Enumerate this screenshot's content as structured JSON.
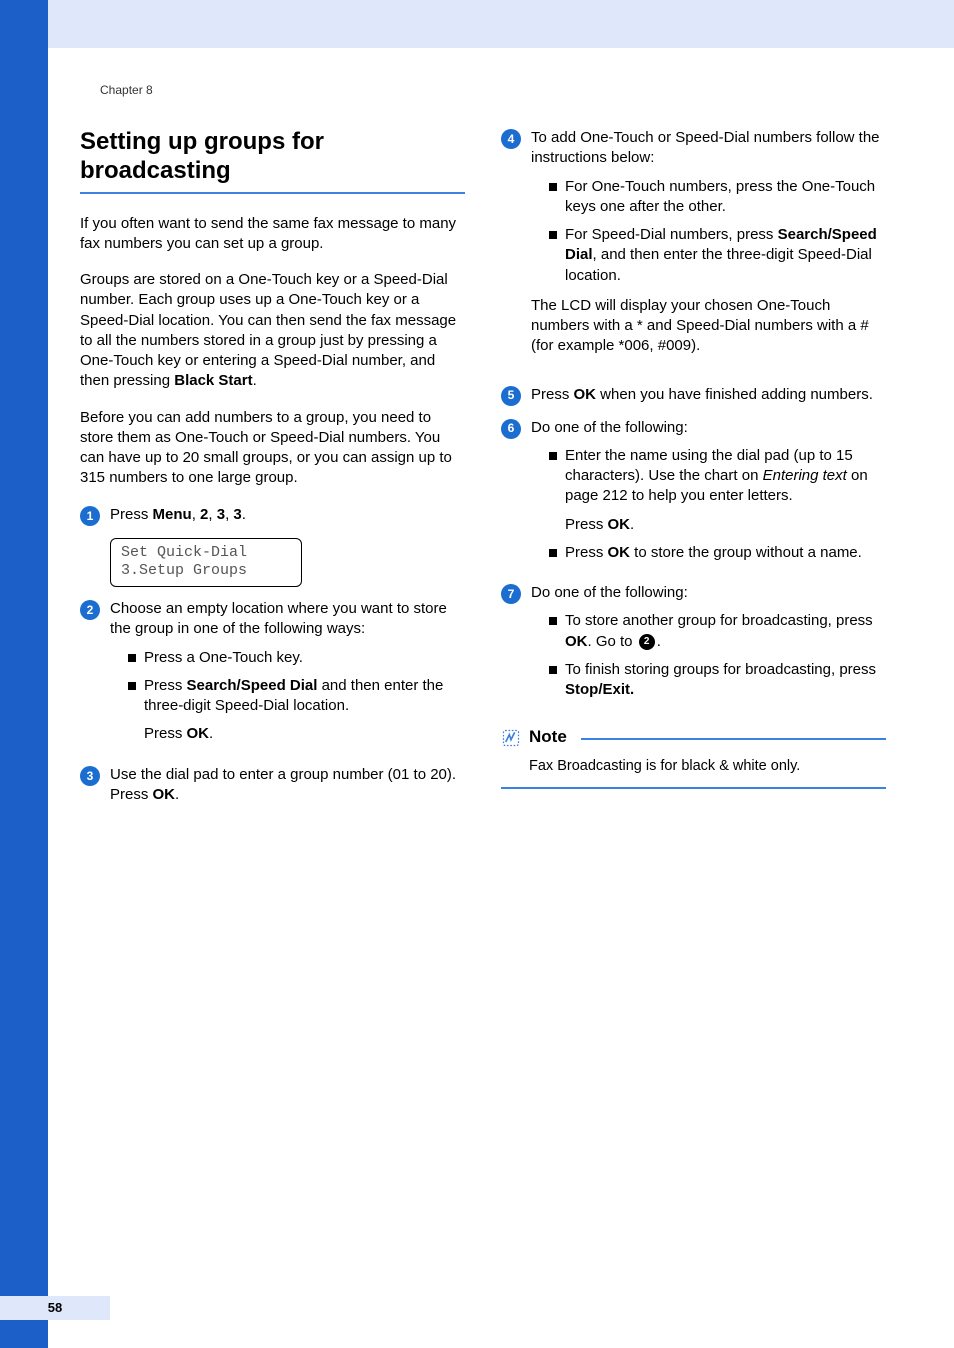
{
  "chapter": "Chapter 8",
  "page_number": "58",
  "title": "Setting up groups for broadcasting",
  "intro_p1": "If you often want to send the same fax message to many fax numbers you can set up a group.",
  "intro_p2_a": "Groups are stored on a One-Touch key or a Speed-Dial number. Each group uses up a One-Touch key or a Speed-Dial location. You can then send the fax message to all the numbers stored in a group just by pressing a One-Touch key or entering a Speed-Dial number, and then pressing ",
  "intro_p2_b": "Black Start",
  "intro_p2_c": ".",
  "intro_p3": "Before you can add numbers to a group, you need to store them as One-Touch or Speed-Dial numbers. You can have up to 20 small groups, or you can assign up to 315 numbers to one large group.",
  "step1_a": "Press ",
  "step1_menu": "Menu",
  "step1_b": ", ",
  "step1_n1": "2",
  "step1_n2": "3",
  "step1_n3": "3",
  "step1_dot": ".",
  "lcd_line1": "Set Quick-Dial",
  "lcd_line2": "3.Setup Groups",
  "step2": "Choose an empty location where you want to store the group in one of the following ways:",
  "step2_b1": "Press a One-Touch key.",
  "step2_b2_a": "Press ",
  "step2_b2_b": "Search/Speed Dial",
  "step2_b2_c": " and then enter the three-digit Speed-Dial location.",
  "step2_press_a": "Press ",
  "step2_press_b": "OK",
  "step2_press_c": ".",
  "step3_a": "Use the dial pad to enter a group number (01 to 20).",
  "step3_b": "Press ",
  "step3_c": "OK",
  "step3_d": ".",
  "step4": "To add One-Touch or Speed-Dial numbers follow the instructions below:",
  "step4_b1": "For One-Touch numbers, press the One-Touch keys one after the other.",
  "step4_b2_a": "For Speed-Dial numbers, press ",
  "step4_b2_b": "Search/Speed Dial",
  "step4_b2_c": ", and then enter the three-digit Speed-Dial location.",
  "step4_tail": "The LCD will display your chosen One-Touch numbers with a * and Speed-Dial numbers with a # (for example *006, #009).",
  "step5_a": "Press ",
  "step5_b": "OK",
  "step5_c": " when you have finished adding numbers.",
  "step6": "Do one of the following:",
  "step6_b1_a": "Enter the name using the dial pad (up to 15 characters). Use the chart on ",
  "step6_b1_i": "Entering text",
  "step6_b1_b": " on page 212 to help you enter letters.",
  "step6_press_a": "Press ",
  "step6_press_b": "OK",
  "step6_press_c": ".",
  "step6_b2_a": "Press ",
  "step6_b2_b": "OK",
  "step6_b2_c": " to store the group without a name.",
  "step7": "Do one of the following:",
  "step7_b1_a": "To store another group for broadcasting, press ",
  "step7_b1_b": "OK",
  "step7_b1_c": ". Go to ",
  "step7_ref": "2",
  "step7_b1_d": ".",
  "step7_b2_a": "To finish storing groups for broadcasting, press ",
  "step7_b2_b": "Stop/Exit.",
  "note_title": "Note",
  "note_body": "Fax Broadcasting is for black & white only."
}
